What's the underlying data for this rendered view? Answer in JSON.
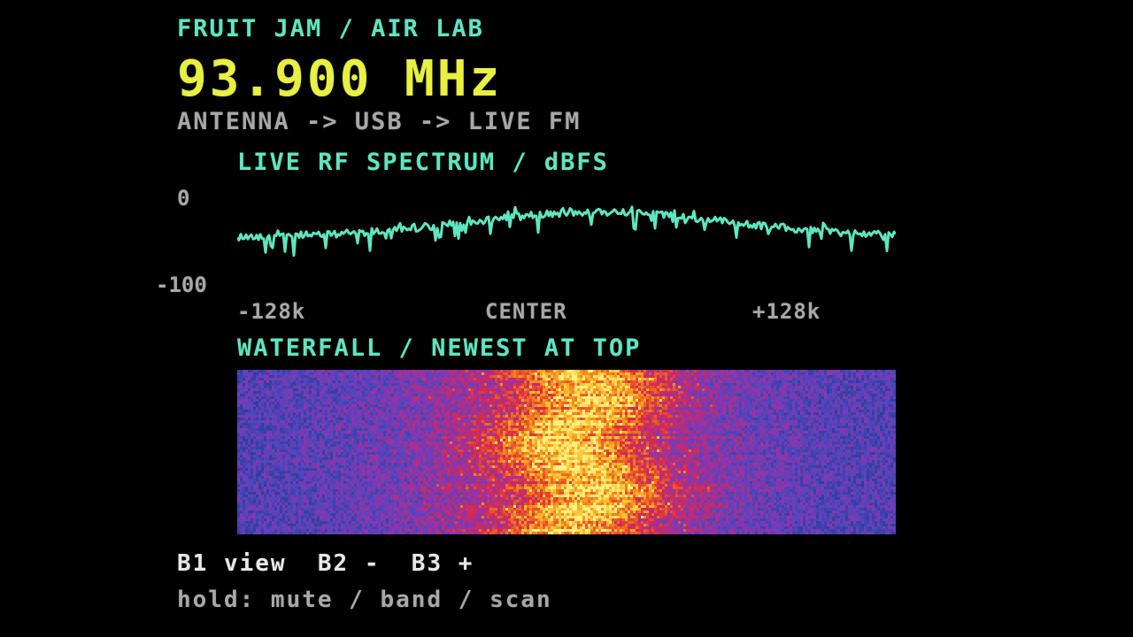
{
  "header": {
    "app_title": "FRUIT JAM / AIR LAB",
    "frequency": "93.900 MHz",
    "signal_path": "ANTENNA -> USB -> LIVE FM"
  },
  "spectrum": {
    "title": "LIVE RF SPECTRUM / dBFS",
    "y_top_label": "0",
    "y_bottom_label": "-100",
    "x_left_label": "-128k",
    "x_center_label": "CENTER",
    "x_right_label": "+128k",
    "trace_color": "#5ee6c0"
  },
  "waterfall": {
    "title": "WATERFALL / NEWEST AT TOP"
  },
  "controls": {
    "buttons_line": "B1 view  B2 -  B3 +",
    "hold_line": "hold: mute / band / scan"
  },
  "colors": {
    "accent": "#5ee6c0",
    "frequency": "#e8f040",
    "muted": "#a8a8a8",
    "background": "#000000"
  }
}
